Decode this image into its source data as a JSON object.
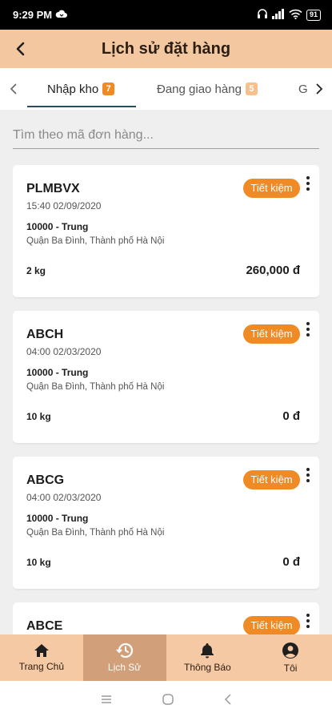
{
  "status_bar": {
    "time": "9:29 PM",
    "battery": "91"
  },
  "app_bar": {
    "title": "Lịch sử đặt hàng"
  },
  "tabs": [
    {
      "label": "Nhập kho",
      "badge": "7"
    },
    {
      "label": "Đang giao hàng",
      "badge": "5"
    },
    {
      "label": "G"
    }
  ],
  "search": {
    "placeholder": "Tìm theo mã đơn hàng..."
  },
  "orders": [
    {
      "code": "PLMBVX",
      "date": "15:40 02/09/2020",
      "receiver": "10000 - Trung",
      "address": "Quận Ba Đình, Thành phố Hà Nội",
      "weight": "2 kg",
      "price": "260,000 đ",
      "tag": "Tiết kiệm"
    },
    {
      "code": "ABCH",
      "date": "04:00 02/03/2020",
      "receiver": "10000 - Trung",
      "address": "Quận Ba Đình, Thành phố Hà Nội",
      "weight": "10 kg",
      "price": "0 đ",
      "tag": "Tiết kiệm"
    },
    {
      "code": "ABCG",
      "date": "04:00 02/03/2020",
      "receiver": "10000 - Trung",
      "address": "Quận Ba Đình, Thành phố Hà Nội",
      "weight": "10 kg",
      "price": "0 đ",
      "tag": "Tiết kiệm"
    },
    {
      "code": "ABCE",
      "tag": "Tiết kiệm"
    }
  ],
  "bottom_nav": [
    {
      "label": "Trang Chủ",
      "icon": "home-icon"
    },
    {
      "label": "Lịch Sử",
      "icon": "history-icon"
    },
    {
      "label": "Thông Báo",
      "icon": "bell-icon"
    },
    {
      "label": "Tôi",
      "icon": "account-icon"
    }
  ],
  "colors": {
    "accent": "#f08a24",
    "app_bar": "#f3c79f",
    "bottom_nav": "#f5c9a3",
    "bottom_nav_active": "#d1a07a"
  }
}
